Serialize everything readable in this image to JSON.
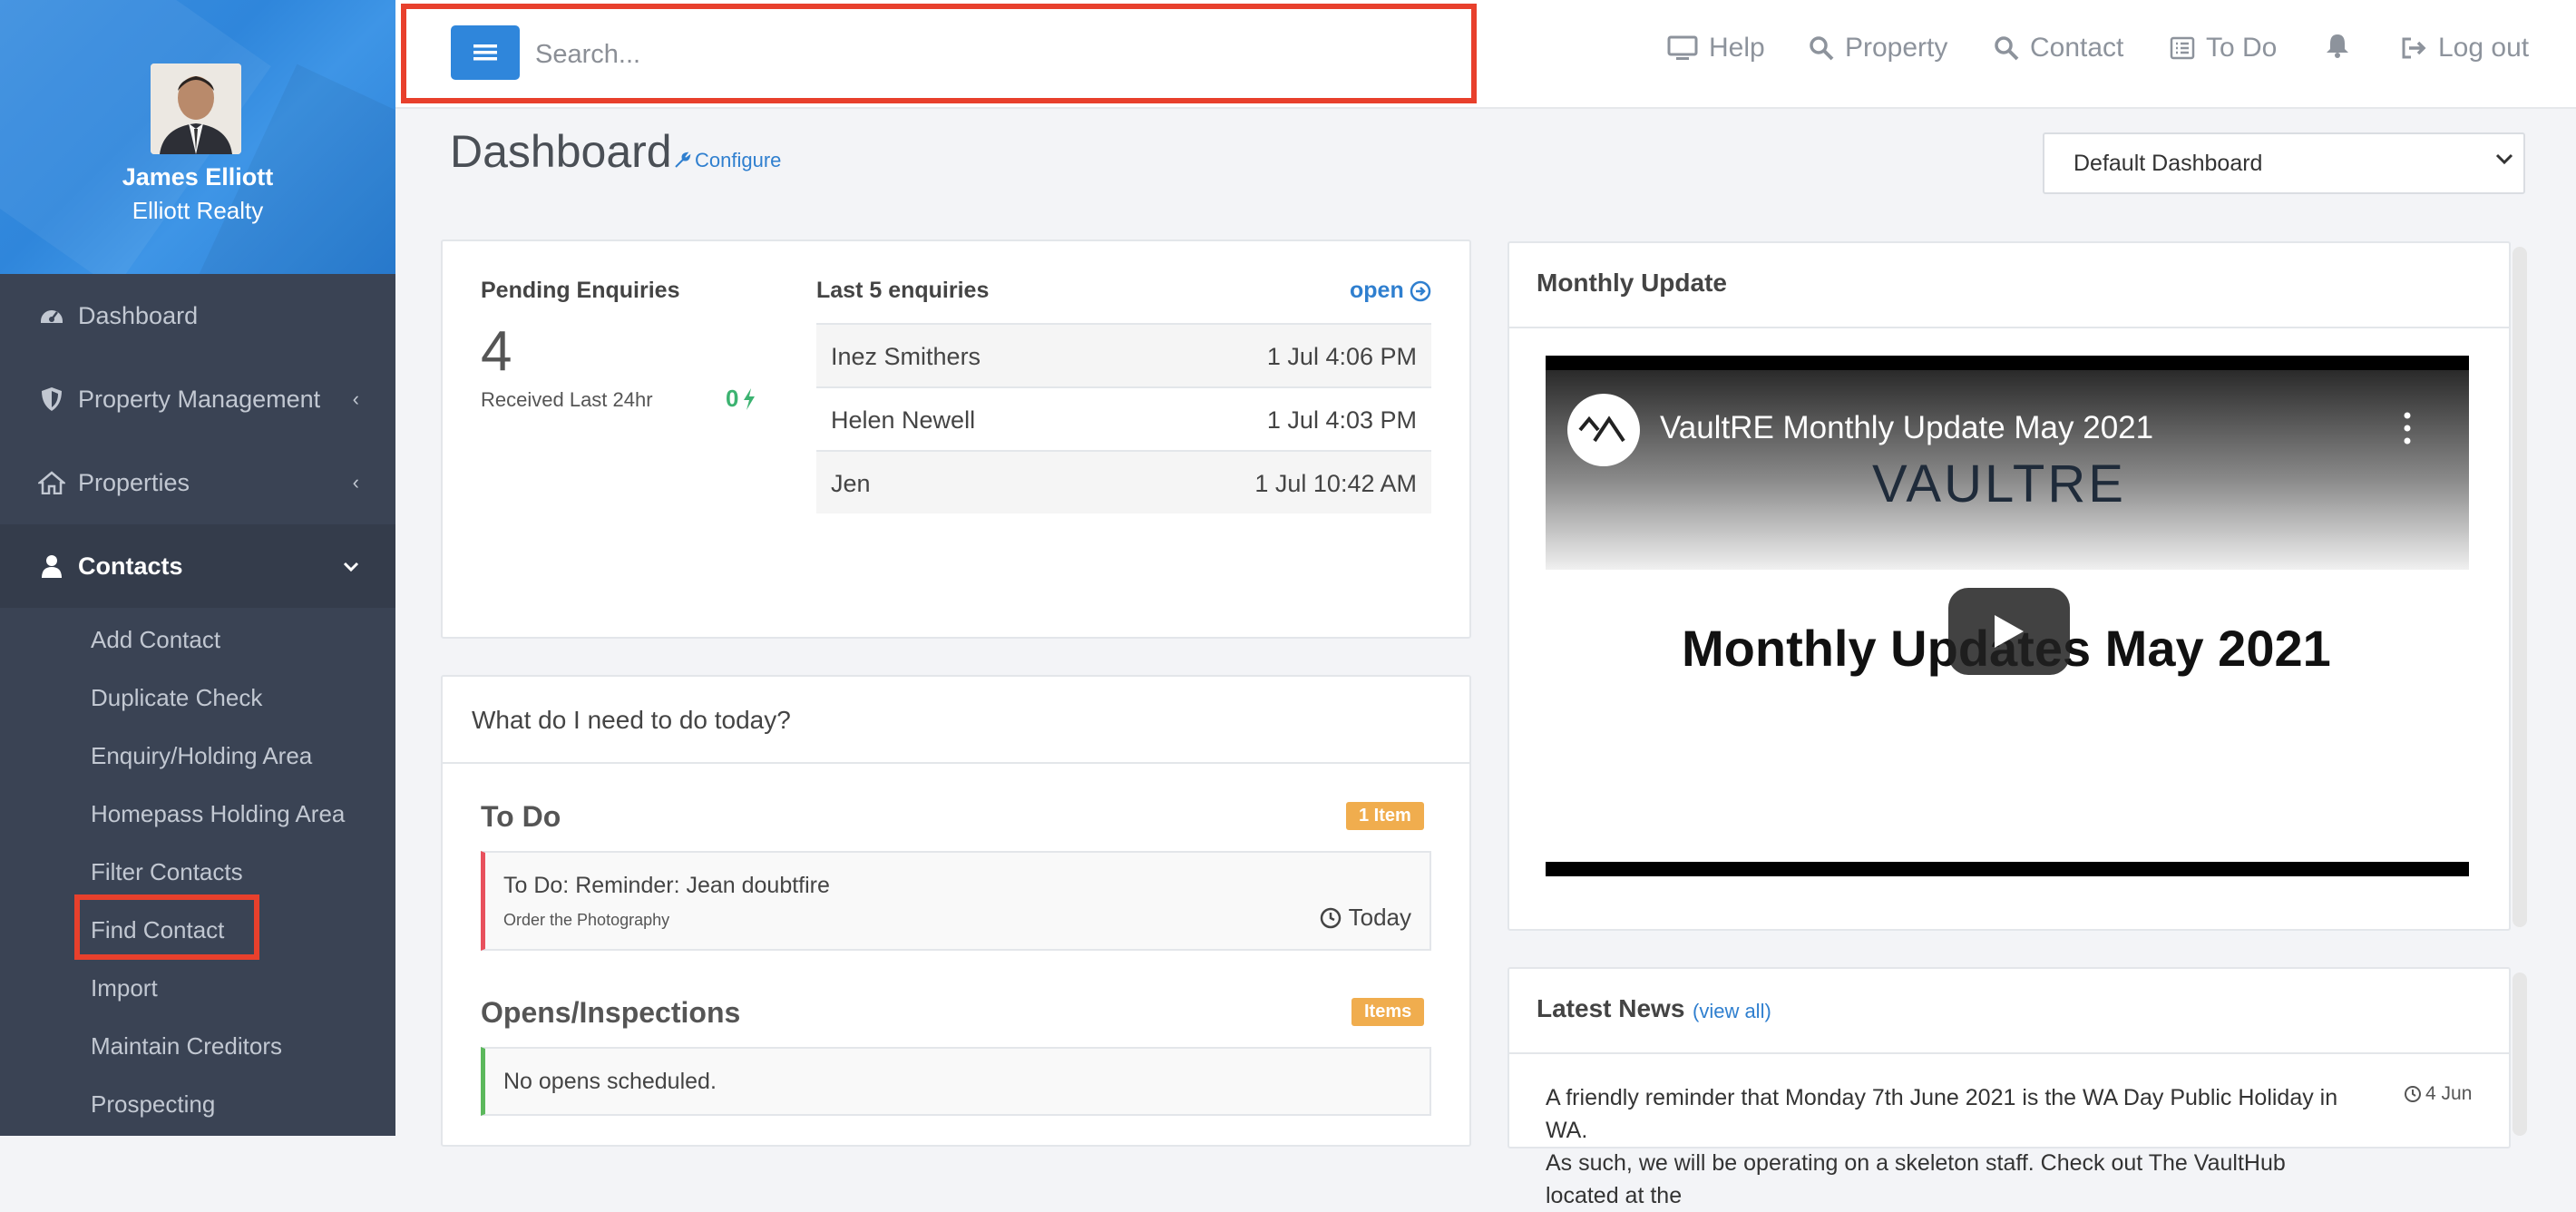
{
  "sidebar": {
    "user_name": "James Elliott",
    "company": "Elliott Realty",
    "items": [
      {
        "label": "Dashboard",
        "icon": "dashboard-icon"
      },
      {
        "label": "Property Management",
        "icon": "shield-icon"
      },
      {
        "label": "Properties",
        "icon": "home-icon"
      },
      {
        "label": "Contacts",
        "icon": "user-icon"
      }
    ],
    "contacts_sub": [
      "Add Contact",
      "Duplicate Check",
      "Enquiry/Holding Area",
      "Homepass Holding Area",
      "Filter Contacts",
      "Find Contact",
      "Import",
      "Maintain Creditors",
      "Prospecting"
    ]
  },
  "topbar": {
    "search_placeholder": "Search...",
    "links": [
      {
        "label": "Help",
        "icon": "monitor-icon"
      },
      {
        "label": "Property",
        "icon": "search-icon"
      },
      {
        "label": "Contact",
        "icon": "search-icon"
      },
      {
        "label": "To Do",
        "icon": "list-icon"
      },
      {
        "label": "",
        "icon": "bell-icon"
      },
      {
        "label": "Log out",
        "icon": "logout-icon"
      }
    ]
  },
  "header": {
    "title": "Dashboard",
    "configure": "Configure",
    "dashboard_select": "Default Dashboard"
  },
  "enquiries": {
    "pending_label": "Pending Enquiries",
    "pending_count": "4",
    "received_label": "Received Last 24hr",
    "received_count": "0",
    "last5_label": "Last 5 enquiries",
    "open_label": "open",
    "rows": [
      {
        "name": "Inez Smithers",
        "date": "1 Jul 4:06 PM"
      },
      {
        "name": "Helen Newell",
        "date": "1 Jul 4:03 PM"
      },
      {
        "name": "Jen",
        "date": "1 Jul 10:42 AM"
      }
    ]
  },
  "today": {
    "heading": "What do I need to do today?",
    "todo_title": "To Do",
    "todo_badge": "1 Item",
    "todo_item_title": "To Do: Reminder: Jean doubtfire",
    "todo_item_sub": "Order the Photography",
    "todo_item_when": "Today",
    "opens_title": "Opens/Inspections",
    "opens_badge": "Items",
    "opens_empty": "No opens scheduled."
  },
  "monthly": {
    "heading": "Monthly Update",
    "video_title": "VaultRE Monthly Update May 2021",
    "video_brand": "VAULTRE",
    "video_caption": "Monthly Updates May 2021"
  },
  "news": {
    "heading": "Latest News",
    "view_all": "(view all)",
    "date": "4 Jun",
    "line1": "A friendly reminder that Monday 7th June 2021 is the WA Day Public Holiday in WA.",
    "line2": "As such, we will be operating on a skeleton staff. Check out The VaultHub located at the"
  },
  "colors": {
    "brand_blue": "#2f86db",
    "sidebar_bg": "#3a4354",
    "highlight_red": "#e8402c",
    "badge_orange": "#f0ad4e",
    "success_green": "#3cb371"
  }
}
